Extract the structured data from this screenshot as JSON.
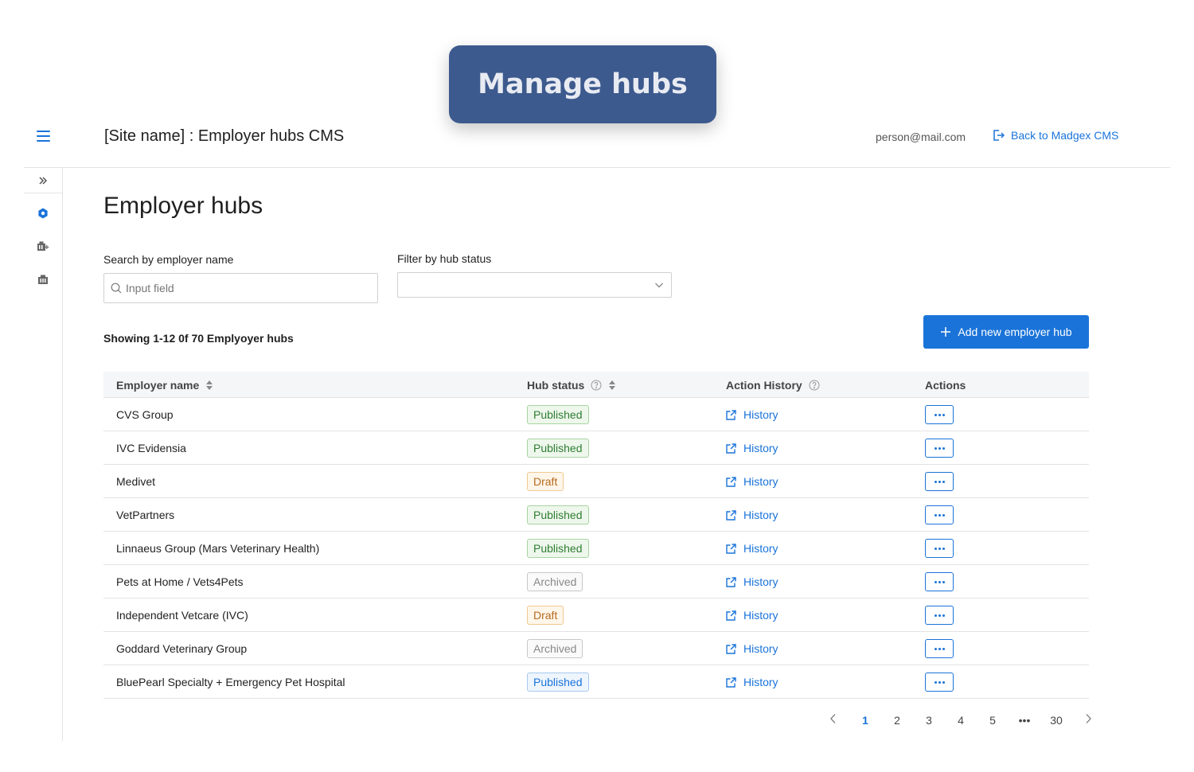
{
  "banner": {
    "title": "Manage hubs"
  },
  "header": {
    "title": "[Site name] : Employer hubs CMS",
    "user_email": "person@mail.com",
    "back_label": "Back to Madgex CMS"
  },
  "colors": {
    "accent": "#1a73d9",
    "banner": "#3d5a8e",
    "published": "#2e7d32",
    "draft": "#b56a1f",
    "archived": "#888888"
  },
  "page": {
    "title": "Employer hubs"
  },
  "search": {
    "label": "Search by employer name",
    "placeholder": "Input field"
  },
  "filter": {
    "label": "Filter by hub status",
    "value": ""
  },
  "summary": {
    "showing": "Showing 1-12 0f 70 Emplyoyer hubs"
  },
  "add_button": {
    "label": "Add new employer hub"
  },
  "table": {
    "headers": {
      "employer": "Employer name",
      "status": "Hub status",
      "history": "Action History",
      "actions": "Actions"
    },
    "rows": [
      {
        "name": "CVS Group",
        "status": "Published",
        "status_type": "published",
        "history": "History"
      },
      {
        "name": "IVC Evidensia",
        "status": "Published",
        "status_type": "published",
        "history": "History"
      },
      {
        "name": "Medivet",
        "status": "Draft",
        "status_type": "draft",
        "history": "History"
      },
      {
        "name": "VetPartners",
        "status": "Published",
        "status_type": "published",
        "history": "History"
      },
      {
        "name": "Linnaeus Group (Mars Veterinary Health)",
        "status": "Published",
        "status_type": "published",
        "history": "History"
      },
      {
        "name": "Pets at Home / Vets4Pets",
        "status": "Archived",
        "status_type": "archived",
        "history": "History"
      },
      {
        "name": "Independent Vetcare (IVC)",
        "status": "Draft",
        "status_type": "draft",
        "history": "History"
      },
      {
        "name": "Goddard Veterinary Group",
        "status": "Archived",
        "status_type": "archived",
        "history": "History"
      },
      {
        "name": "BluePearl Specialty + Emergency Pet Hospital",
        "status": "Published",
        "status_type": "published-blue",
        "history": "History"
      }
    ]
  },
  "pagination": {
    "pages": [
      "1",
      "2",
      "3",
      "4",
      "5",
      "•••",
      "30"
    ],
    "current": "1"
  }
}
